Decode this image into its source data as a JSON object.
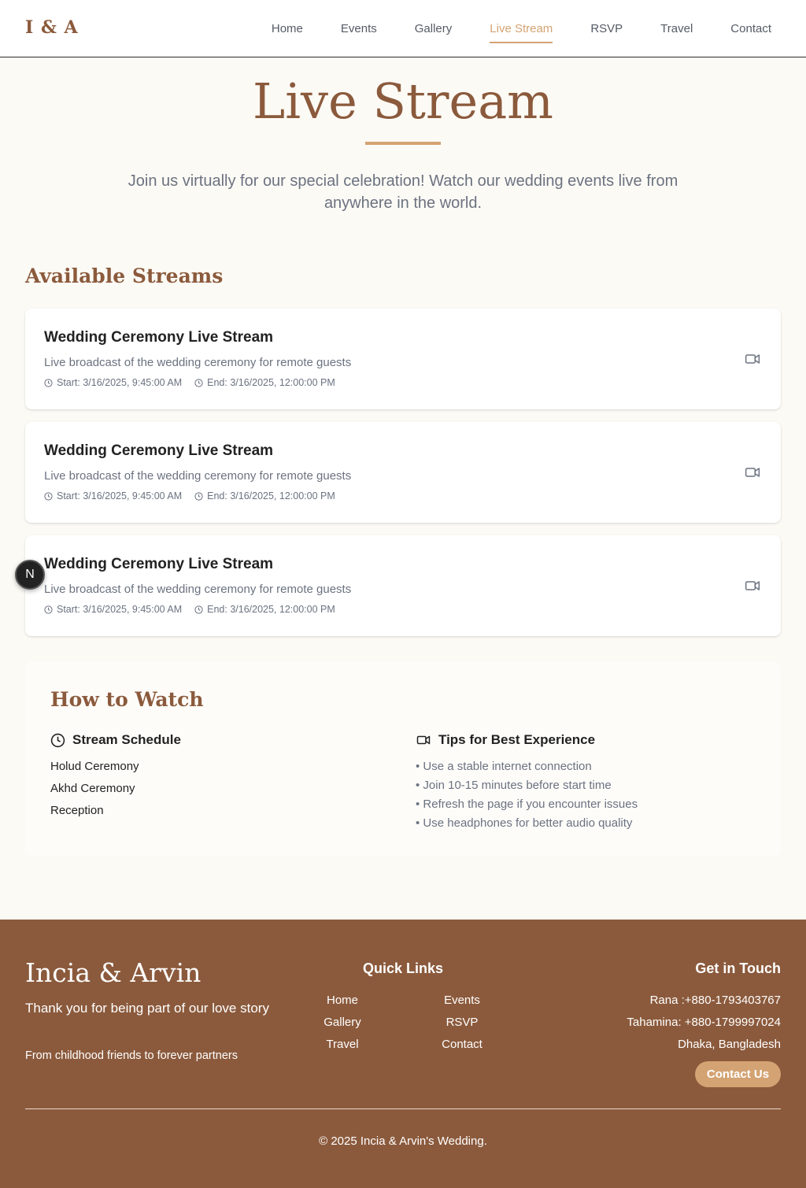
{
  "header": {
    "logo": "I & A",
    "nav": [
      "Home",
      "Events",
      "Gallery",
      "Live Stream",
      "RSVP",
      "Travel",
      "Contact"
    ],
    "active": "Live Stream"
  },
  "hero": {
    "title": "Live Stream",
    "subtitle": "Join us virtually for our special celebration! Watch our wedding events live from anywhere in the world."
  },
  "streams_section": {
    "title": "Available Streams",
    "items": [
      {
        "title": "Wedding Ceremony Live Stream",
        "description": "Live broadcast of the wedding ceremony for remote guests",
        "start": "Start: 3/16/2025, 9:45:00 AM",
        "end": "End: 3/16/2025, 12:00:00 PM"
      },
      {
        "title": "Wedding Ceremony Live Stream",
        "description": "Live broadcast of the wedding ceremony for remote guests",
        "start": "Start: 3/16/2025, 9:45:00 AM",
        "end": "End: 3/16/2025, 12:00:00 PM"
      },
      {
        "title": "Wedding Ceremony Live Stream",
        "description": "Live broadcast of the wedding ceremony for remote guests",
        "start": "Start: 3/16/2025, 9:45:00 AM",
        "end": "End: 3/16/2025, 12:00:00 PM"
      }
    ],
    "icons": {
      "time": "clock-icon",
      "stream": "video-camera-icon"
    }
  },
  "floating_badge": {
    "label": "N"
  },
  "how_to_watch": {
    "title": "How to Watch",
    "schedule_title": "Stream Schedule",
    "schedule": [
      "Holud Ceremony",
      "Akhd Ceremony",
      "Reception"
    ],
    "tips_title": "Tips for Best Experience",
    "tips": [
      "• Use a stable internet connection",
      "• Join 10-15 minutes before start time",
      "• Refresh the page if you encounter issues",
      "• Use headphones for better audio quality"
    ]
  },
  "footer": {
    "brand": "Incia & Arvin",
    "tagline": "Thank you for being part of our love story",
    "subline": "From childhood friends to forever partners",
    "quick_links_title": "Quick Links",
    "quick_links": [
      "Home",
      "Events",
      "Gallery",
      "RSVP",
      "Travel",
      "Contact"
    ],
    "contact_title": "Get in Touch",
    "contacts": [
      "Rana :+880-1793403767",
      "Tahamina: +880-1799997024",
      "Dhaka, Bangladesh"
    ],
    "contact_button": "Contact Us",
    "copyright": "© 2025 Incia & Arvin's Wedding."
  },
  "colors": {
    "brand": "#8b5a3c",
    "accent": "#d4a373",
    "background": "#fcfaf5",
    "muted_text": "#6b7280"
  }
}
